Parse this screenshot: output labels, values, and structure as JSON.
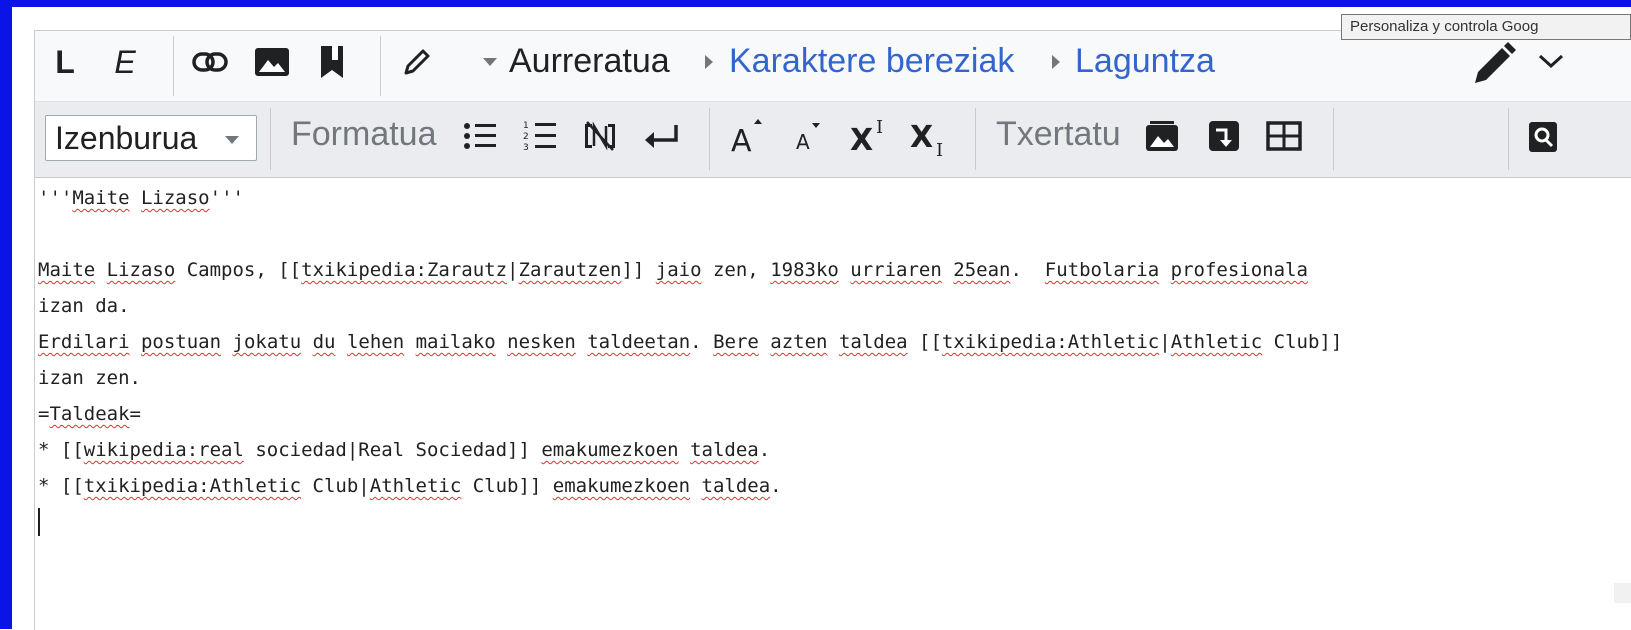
{
  "tooltip": {
    "text": "Personaliza y controla Goog"
  },
  "toolbar1": {
    "bold_label": "L",
    "italic_label": "E",
    "advanced_label": "Aurreratua",
    "special_chars_label": "Karaktere bereziak",
    "help_label": "Laguntza"
  },
  "toolbar2": {
    "heading_select_value": "Izenburua",
    "format_label": "Formatua",
    "insert_label": "Txertatu"
  },
  "editor": {
    "lines": [
      "'''Maite Lizaso'''",
      "",
      "Maite Lizaso Campos, [[txikipedia:Zarautz|Zarautzen]] jaio zen, 1983ko urriaren 25ean.  Futbolaria profesionala",
      "izan da.",
      "Erdilari postuan jokatu du lehen mailako nesken taldeetan. Bere azten taldea [[txikipedia:Athletic|Athletic Club]]",
      "izan zen.",
      "=Taldeak=",
      "* [[wikipedia:real sociedad|Real Sociedad]] emakumezkoen taldea.",
      "* [[txikipedia:Athletic Club|Athletic Club]] emakumezkoen taldea."
    ]
  },
  "colors": {
    "frame_border": "#0a14e6",
    "link_blue": "#3366cc",
    "spell_underline": "#dd3333"
  }
}
